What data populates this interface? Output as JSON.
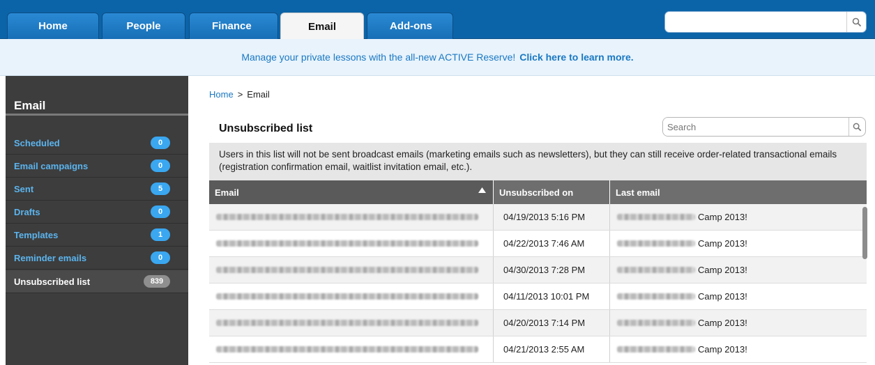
{
  "nav": {
    "tabs": [
      {
        "label": "Home"
      },
      {
        "label": "People"
      },
      {
        "label": "Finance"
      },
      {
        "label": "Email"
      },
      {
        "label": "Add-ons"
      }
    ],
    "active_tab": "Email",
    "search": {
      "value": "",
      "placeholder": "",
      "icon": "search-icon"
    }
  },
  "banner": {
    "text": "Manage your private lessons with the all-new ACTIVE Reserve!",
    "link": "Click here to learn more."
  },
  "sidebar": {
    "title": "Email",
    "items": [
      {
        "label": "Scheduled",
        "count": "0"
      },
      {
        "label": "Email campaigns",
        "count": "0"
      },
      {
        "label": "Sent",
        "count": "5"
      },
      {
        "label": "Drafts",
        "count": "0"
      },
      {
        "label": "Templates",
        "count": "1"
      },
      {
        "label": "Reminder emails",
        "count": "0"
      },
      {
        "label": "Unsubscribed list",
        "count": "839"
      }
    ],
    "active_item": "Unsubscribed list"
  },
  "breadcrumb": {
    "home": "Home",
    "separator": ">",
    "current": "Email"
  },
  "page": {
    "title": "Unsubscribed list",
    "search_placeholder": "Search",
    "note": "Users in this list will not be sent broadcast emails (marketing emails such as newsletters), but they can still receive order-related transactional emails (registration confirmation email, waitlist invitation email, etc.)."
  },
  "table": {
    "columns": [
      "Email",
      "Unsubscribed on",
      "Last email"
    ],
    "sort": {
      "column": "Email",
      "direction": "ascending"
    },
    "rows": [
      {
        "unsubscribed_on": "04/19/2013 5:16 PM",
        "last_email": "Camp 2013!"
      },
      {
        "unsubscribed_on": "04/22/2013 7:46 AM",
        "last_email": "Camp 2013!"
      },
      {
        "unsubscribed_on": "04/30/2013 7:28 PM",
        "last_email": "Camp 2013!"
      },
      {
        "unsubscribed_on": "04/11/2013 10:01 PM",
        "last_email": "Camp 2013!"
      },
      {
        "unsubscribed_on": "04/20/2013 7:14 PM",
        "last_email": "Camp 2013!"
      },
      {
        "unsubscribed_on": "04/21/2013 2:55 AM",
        "last_email": "Camp 2013!"
      }
    ]
  },
  "colors": {
    "nav_bg": "#0c64a8",
    "tab_bg": "#176fb6",
    "banner_bg": "#e8f3fc",
    "link": "#1a78c2",
    "sidebar_bg": "#3d3d3d",
    "badge": "#3aa7f0",
    "table_header": "#6e6e6e"
  }
}
